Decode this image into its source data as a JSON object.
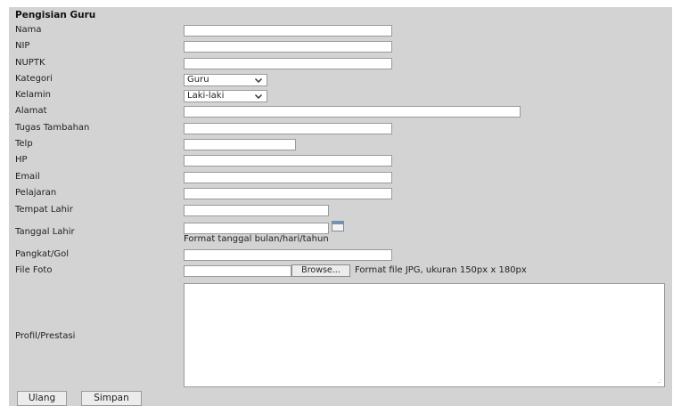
{
  "form": {
    "title": "Pengisian Guru",
    "fields": {
      "nama": {
        "label": "Nama",
        "value": ""
      },
      "nip": {
        "label": "NIP",
        "value": ""
      },
      "nuptk": {
        "label": "NUPTK",
        "value": ""
      },
      "kategori": {
        "label": "Kategori",
        "selected": "Guru"
      },
      "kelamin": {
        "label": "Kelamin",
        "selected": "Laki-laki"
      },
      "alamat": {
        "label": "Alamat",
        "value": ""
      },
      "tugas_tambahan": {
        "label": "Tugas Tambahan",
        "value": ""
      },
      "telp": {
        "label": "Telp",
        "value": ""
      },
      "hp": {
        "label": "HP",
        "value": ""
      },
      "email": {
        "label": "Email",
        "value": ""
      },
      "pelajaran": {
        "label": "Pelajaran",
        "value": ""
      },
      "tempat_lahir": {
        "label": "Tempat Lahir",
        "value": ""
      },
      "tanggal_lahir": {
        "label": "Tanggal Lahir",
        "value": "",
        "hint": "Format tanggal bulan/hari/tahun"
      },
      "pangkat_gol": {
        "label": "Pangkat/Gol",
        "value": ""
      },
      "file_foto": {
        "label": "File Foto",
        "browse_label": "Browse...",
        "hint": "Format file JPG, ukuran 150px x 180px"
      },
      "profil_prestasi": {
        "label": "Profil/Prestasi",
        "value": ""
      }
    },
    "buttons": {
      "reset_label": "Ulang",
      "save_label": "Simpan"
    }
  }
}
